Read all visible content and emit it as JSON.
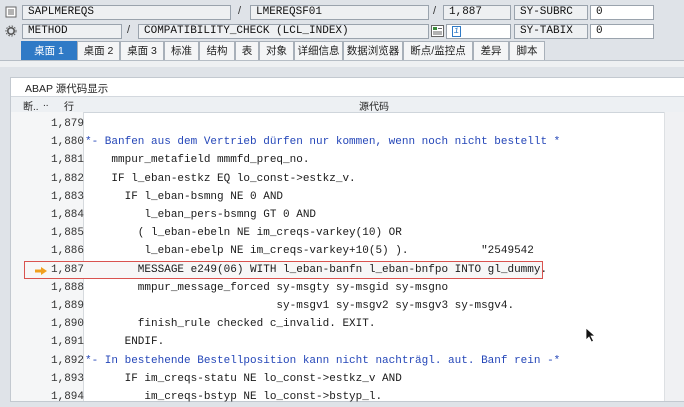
{
  "header": {
    "row1": {
      "program": "SAPLMEREQS",
      "include": "LMEREQSF01",
      "line": "1,887",
      "field_name": "SY-SUBRC",
      "field_value": "0"
    },
    "row2": {
      "type": "METHOD",
      "name": "COMPATIBILITY_CHECK (LCL_INDEX)",
      "field_name": "SY-TABIX",
      "field_value": "0"
    }
  },
  "tabs": [
    "桌面 1",
    "桌面 2",
    "桌面 3",
    "标准",
    "结构",
    "表",
    "对象",
    "详细信息",
    "数据浏览器",
    "断点/监控点",
    "差异",
    "脚本"
  ],
  "panel": {
    "title": "ABAP 源代码显示",
    "col_bp": "断..",
    "col_dot": "..",
    "col_line": "行",
    "col_source": "源代码"
  },
  "current_line": "1,887",
  "colors": {
    "active_tab": "#2f7ac6",
    "comment": "#2446b8",
    "highlight_border": "#d9534f",
    "arrow": "#f0a020"
  },
  "code_lines": [
    {
      "ln": "1,879",
      "text": ""
    },
    {
      "ln": "1,880",
      "text": "*- Banfen aus dem Vertrieb dürfen nur kommen, wenn noch nicht bestellt *"
    },
    {
      "ln": "1,881",
      "text": "    mmpur_metafield mmmfd_preq_no."
    },
    {
      "ln": "1,882",
      "text": "    IF l_eban-estkz EQ lo_const->estkz_v."
    },
    {
      "ln": "1,883",
      "text": "      IF l_eban-bsmng NE 0 AND"
    },
    {
      "ln": "1,884",
      "text": "         l_eban_pers-bsmng GT 0 AND"
    },
    {
      "ln": "1,885",
      "text": "        ( l_eban-ebeln NE im_creqs-varkey(10) OR"
    },
    {
      "ln": "1,886",
      "text": "         l_eban-ebelp NE im_creqs-varkey+10(5) ).           \"2549542"
    },
    {
      "ln": "1,887",
      "text": "        MESSAGE e249(06) WITH l_eban-banfn l_eban-bnfpo INTO gl_dummy."
    },
    {
      "ln": "1,888",
      "text": "        mmpur_message_forced sy-msgty sy-msgid sy-msgno"
    },
    {
      "ln": "1,889",
      "text": "                             sy-msgv1 sy-msgv2 sy-msgv3 sy-msgv4."
    },
    {
      "ln": "1,890",
      "text": "        finish_rule checked c_invalid. EXIT."
    },
    {
      "ln": "1,891",
      "text": "      ENDIF."
    },
    {
      "ln": "1,892",
      "text": "*- In bestehende Bestellposition kann nicht nachträgl. aut. Banf rein -*"
    },
    {
      "ln": "1,893",
      "text": "      IF im_creqs-statu NE lo_const->estkz_v AND"
    },
    {
      "ln": "1,894",
      "text": "         im_creqs-bstyp NE lo_const->bstyp_l."
    }
  ]
}
